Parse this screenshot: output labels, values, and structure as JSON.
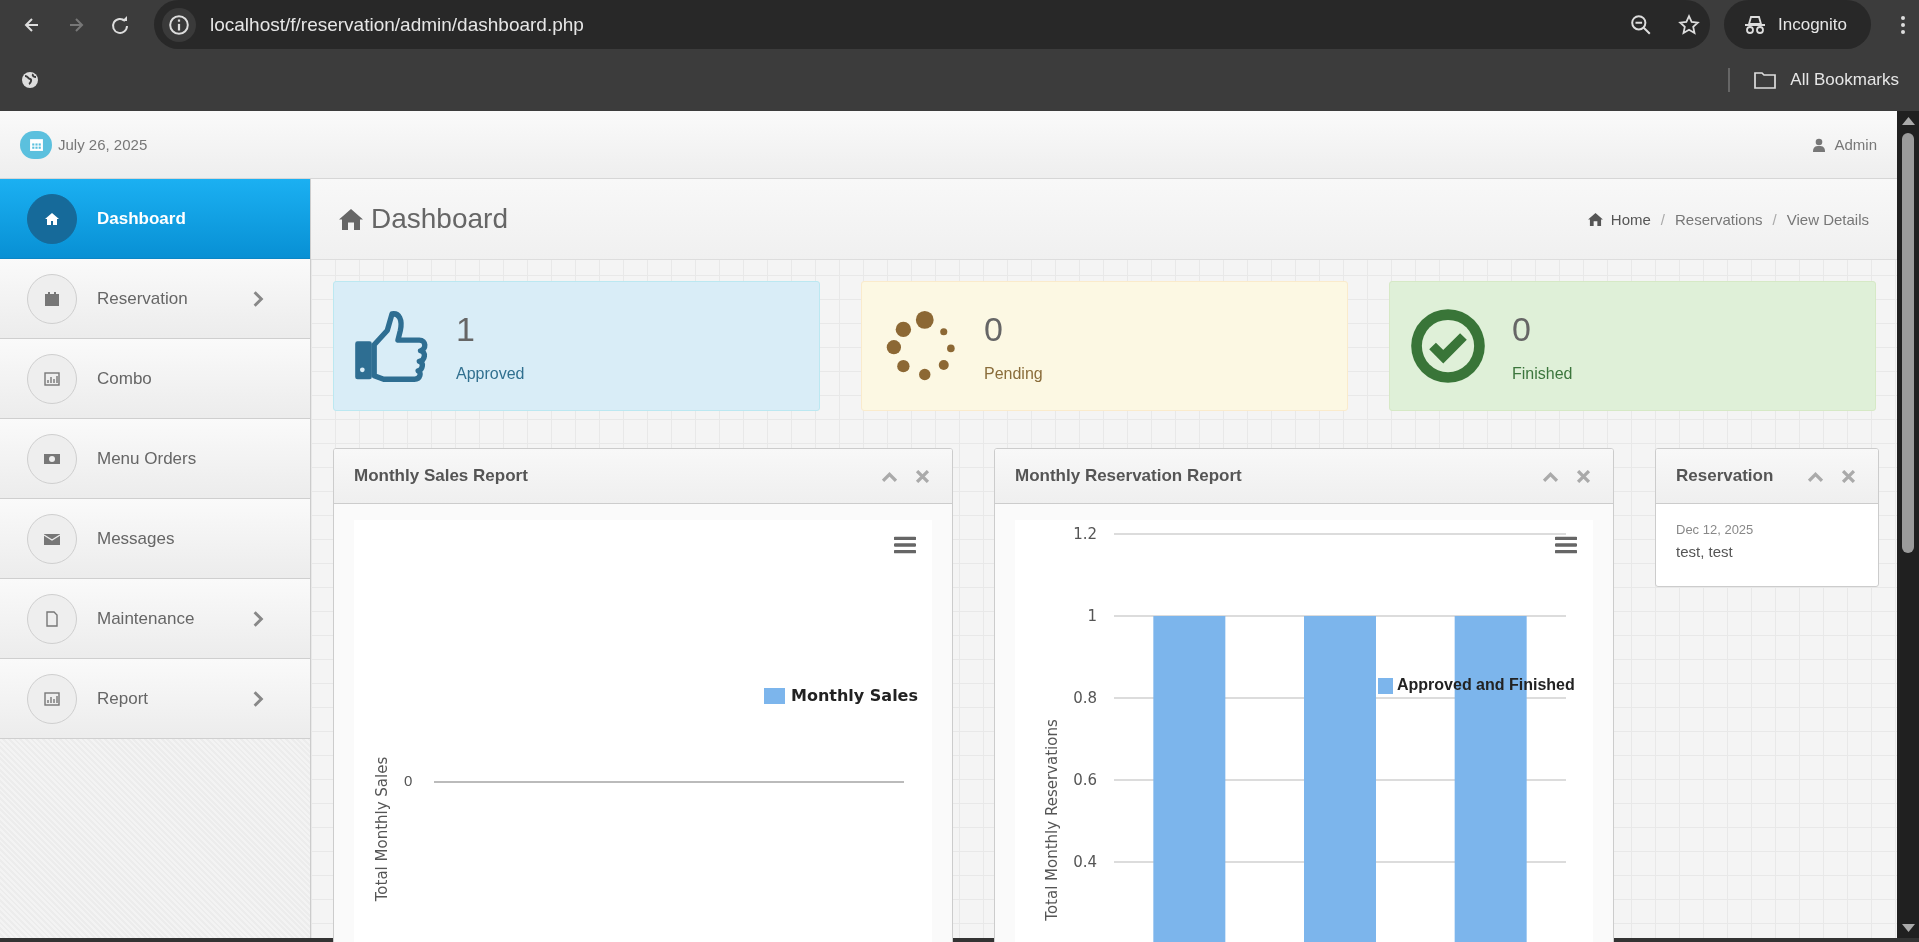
{
  "browser": {
    "url": "localhost/f/reservation/admin/dashboard.php",
    "profile": "Incognito",
    "bookmarks": "All Bookmarks"
  },
  "header": {
    "date": "July 26, 2025",
    "user": "Admin"
  },
  "sidebar": {
    "items": [
      {
        "label": "Dashboard",
        "kind": "home",
        "selected": true,
        "has_submenu": false
      },
      {
        "label": "Reservation",
        "kind": "calendar",
        "selected": false,
        "has_submenu": true
      },
      {
        "label": "Combo",
        "kind": "chart",
        "selected": false,
        "has_submenu": false
      },
      {
        "label": "Menu Orders",
        "kind": "money",
        "selected": false,
        "has_submenu": false
      },
      {
        "label": "Messages",
        "kind": "envelope",
        "selected": false,
        "has_submenu": false
      },
      {
        "label": "Maintenance",
        "kind": "file",
        "selected": false,
        "has_submenu": true
      },
      {
        "label": "Report",
        "kind": "chart",
        "selected": false,
        "has_submenu": true
      }
    ]
  },
  "page_title": "Dashboard",
  "breadcrumbs": [
    {
      "label": "Home"
    },
    {
      "separator": "/",
      "label": "Reservations"
    },
    {
      "separator": "/",
      "label": "View Details"
    }
  ],
  "stats": [
    {
      "value": "1",
      "label": "Approved",
      "kind": "approved"
    },
    {
      "value": "0",
      "label": "Pending",
      "kind": "pending"
    },
    {
      "value": "0",
      "label": "Finished",
      "kind": "finished"
    }
  ],
  "sales_panel": {
    "title": "Monthly Sales Report",
    "ylabel": "Total Monthly Sales",
    "ytick": "0",
    "legend": "Monthly Sales"
  },
  "reservation_report": {
    "title": "Monthly Reservation Report",
    "chart_data": {
      "type": "bar",
      "ylabel": "Total Monthly Reservations",
      "yticks": [
        0.4,
        0.6,
        0.8,
        1,
        1.2
      ],
      "ylim": [
        0.2,
        1.2
      ],
      "grid": true,
      "series": [
        {
          "name": "Approved and Finished",
          "color": "#7cb5ec",
          "values": [
            1,
            1,
            1
          ]
        }
      ]
    }
  },
  "reservation_panel": {
    "title": "Reservation",
    "entries": [
      {
        "date": "Dec 12, 2025",
        "name": "test, test"
      }
    ]
  }
}
